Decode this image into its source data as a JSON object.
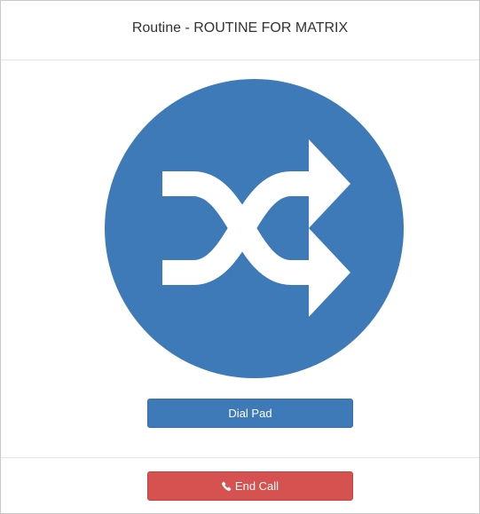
{
  "header": {
    "title": "Routine - ROUTINE FOR MATRIX"
  },
  "main": {
    "icon": "shuffle-icon",
    "icon_bg_color": "#3e79b8",
    "dial_pad_label": "Dial Pad"
  },
  "footer": {
    "end_call_label": "End Call",
    "end_call_icon": "phone-icon",
    "end_call_color": "#d65250"
  },
  "colors": {
    "primary": "#3e79b8",
    "danger": "#d65250"
  }
}
